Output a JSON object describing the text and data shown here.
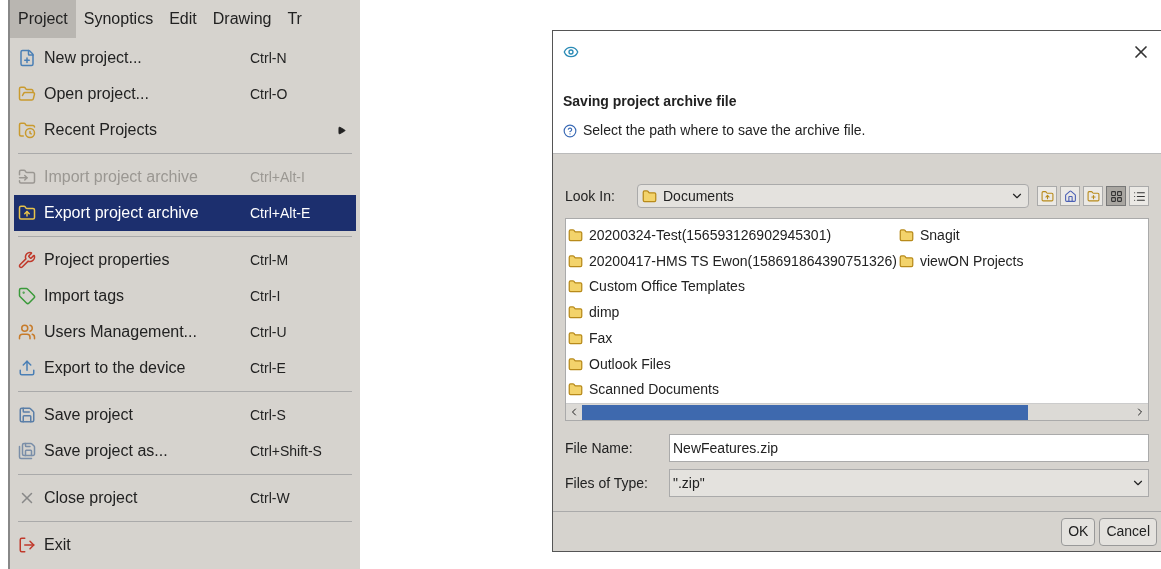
{
  "menubar": [
    {
      "label": "Project",
      "selected": true
    },
    {
      "label": "Synoptics",
      "selected": false
    },
    {
      "label": "Edit",
      "selected": false
    },
    {
      "label": "Drawing",
      "selected": false
    },
    {
      "label": "Tr",
      "selected": false
    }
  ],
  "menu": [
    {
      "kind": "item",
      "label": "New project...",
      "shortcut": "Ctrl-N",
      "disabled": false,
      "selected": false,
      "submenu": false
    },
    {
      "kind": "item",
      "label": "Open project...",
      "shortcut": "Ctrl-O",
      "disabled": false,
      "selected": false,
      "submenu": false
    },
    {
      "kind": "item",
      "label": "Recent Projects",
      "disabled": false,
      "selected": false,
      "submenu": true
    },
    {
      "kind": "separator"
    },
    {
      "kind": "item",
      "label": "Import project archive",
      "shortcut": "Ctrl+Alt-I",
      "disabled": true,
      "selected": false,
      "submenu": false
    },
    {
      "kind": "item",
      "label": "Export project archive",
      "shortcut": "Ctrl+Alt-E",
      "disabled": false,
      "selected": true,
      "submenu": false
    },
    {
      "kind": "separator"
    },
    {
      "kind": "item",
      "label": "Project properties",
      "shortcut": "Ctrl-M",
      "disabled": false,
      "selected": false,
      "submenu": false
    },
    {
      "kind": "item",
      "label": "Import tags",
      "shortcut": "Ctrl-I",
      "disabled": false,
      "selected": false,
      "submenu": false
    },
    {
      "kind": "item",
      "label": "Users Management...",
      "shortcut": "Ctrl-U",
      "disabled": false,
      "selected": false,
      "submenu": false
    },
    {
      "kind": "item",
      "label": "Export to the device",
      "shortcut": "Ctrl-E",
      "disabled": false,
      "selected": false,
      "submenu": false
    },
    {
      "kind": "separator"
    },
    {
      "kind": "item",
      "label": "Save project",
      "shortcut": "Ctrl-S",
      "disabled": false,
      "selected": false,
      "submenu": false
    },
    {
      "kind": "item",
      "label": "Save project as...",
      "shortcut": "Ctrl+Shift-S",
      "disabled": false,
      "selected": false,
      "submenu": false
    },
    {
      "kind": "separator"
    },
    {
      "kind": "item",
      "label": "Close project",
      "shortcut": "Ctrl-W",
      "disabled": false,
      "selected": false,
      "submenu": false
    },
    {
      "kind": "separator"
    },
    {
      "kind": "item",
      "label": "Exit",
      "disabled": false,
      "selected": false,
      "submenu": false
    }
  ],
  "dialog": {
    "heading": "Saving project archive file",
    "message": "Select the path where to save the archive file.",
    "look_in": {
      "label": "Look In:",
      "value": "Documents"
    },
    "views": [
      {
        "selected": true
      },
      {
        "selected": false
      }
    ],
    "files": [
      {
        "name": "20200324-Test(156593126902945301)"
      },
      {
        "name": "20200417-HMS TS Ewon(158691864390751326)"
      },
      {
        "name": "Custom Office Templates"
      },
      {
        "name": "dimp"
      },
      {
        "name": "Fax"
      },
      {
        "name": "Outlook Files"
      },
      {
        "name": "Scanned Documents"
      },
      {
        "name": "Snagit"
      },
      {
        "name": "viewON Projects"
      }
    ],
    "file_name": {
      "label": "File Name:",
      "value": "NewFeatures.zip"
    },
    "file_type": {
      "label": "Files of Type:",
      "value": "\".zip\""
    },
    "buttons": [
      "OK",
      "Cancel"
    ]
  }
}
